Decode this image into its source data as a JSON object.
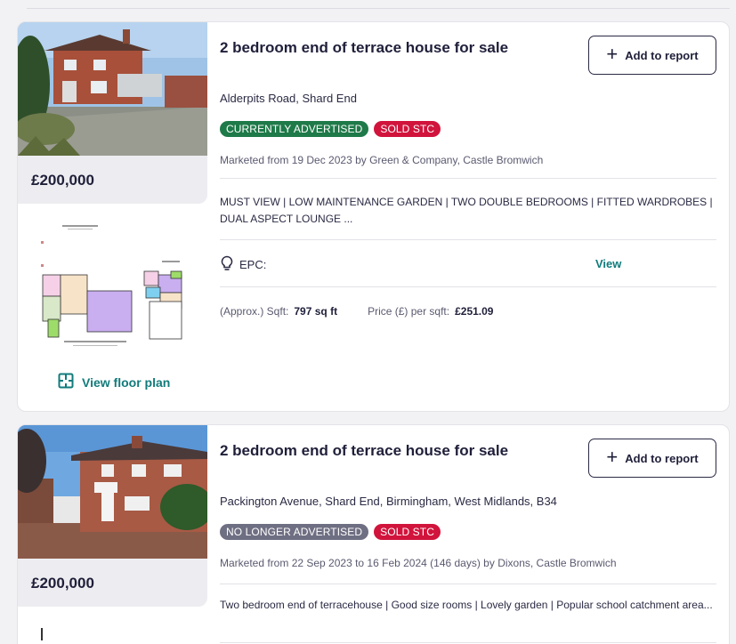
{
  "listings": [
    {
      "price": "£200,000",
      "title": "2 bedroom end of terrace house for sale",
      "add_to_report": "Add to report",
      "address": "Alderpits Road, Shard End",
      "badges": [
        "CURRENTLY ADVERTISED",
        "SOLD STC"
      ],
      "marketed": "Marketed from 19 Dec 2023 by Green & Company, Castle Bromwich",
      "description": "MUST VIEW | LOW MAINTENANCE GARDEN | TWO DOUBLE BEDROOMS | FITTED WARDROBES | DUAL ASPECT LOUNGE ...",
      "epc_label": "EPC:",
      "epc_view": "View",
      "sqft_label": "(Approx.) Sqft:",
      "sqft_value": "797 sq ft",
      "ppsf_label": "Price (£) per sqft:",
      "ppsf_value": "£251.09",
      "floor_plan_link": "View floor plan"
    },
    {
      "price": "£200,000",
      "title": "2 bedroom end of terrace house for sale",
      "add_to_report": "Add to report",
      "address": "Packington Avenue, Shard End, Birmingham, West Midlands, B34",
      "badges": [
        "NO LONGER ADVERTISED",
        "SOLD STC"
      ],
      "marketed": "Marketed from 22 Sep 2023 to 16 Feb 2024 (146 days) by Dixons, Castle Bromwich",
      "description": "Two bedroom end of terracehouse | Good size rooms | Lovely garden | Popular school catchment area..."
    }
  ],
  "colors": {
    "accent": "#127b7b",
    "badge_green": "#1e7a48",
    "badge_red": "#d1143c",
    "badge_grey": "#6f6f83"
  },
  "icons": {
    "plus": "plus-icon",
    "bulb": "lightbulb-icon",
    "floorplan": "floor-plan-icon"
  }
}
